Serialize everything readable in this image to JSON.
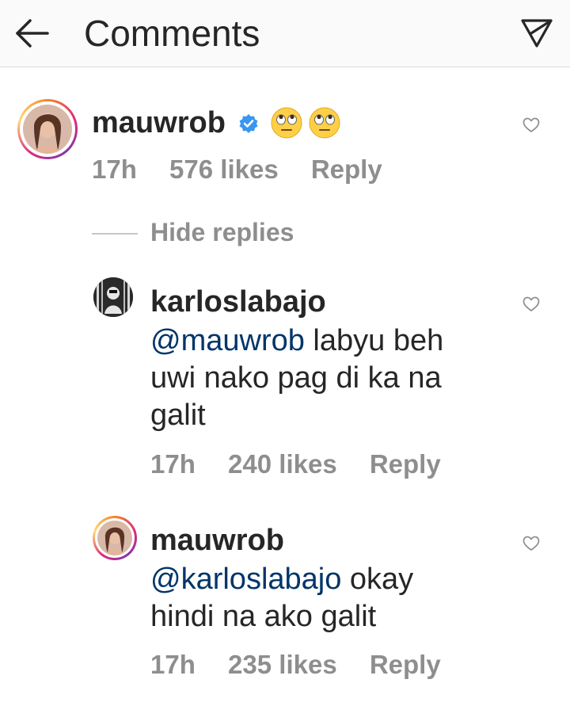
{
  "header": {
    "title": "Comments",
    "back_icon": "back-arrow-icon",
    "send_icon": "send-icon"
  },
  "comment": {
    "username": "mauwrob",
    "verified": true,
    "emoji": "🙄🙄",
    "time": "17h",
    "likes": "576 likes",
    "reply": "Reply",
    "hide_replies": "Hide replies"
  },
  "replies": [
    {
      "username": "karloslabajo",
      "mention": "@mauwrob",
      "text": " labyu beh uwi nako pag di ka na galit",
      "time": "17h",
      "likes": "240 likes",
      "reply": "Reply"
    },
    {
      "username": "mauwrob",
      "mention": "@karloslabajo",
      "text": " okay hindi na ako galit",
      "time": "17h",
      "likes": "235 likes",
      "reply": "Reply"
    }
  ],
  "colors": {
    "mention": "#003569",
    "meta": "#8e8e8e",
    "verified": "#3897f0"
  }
}
